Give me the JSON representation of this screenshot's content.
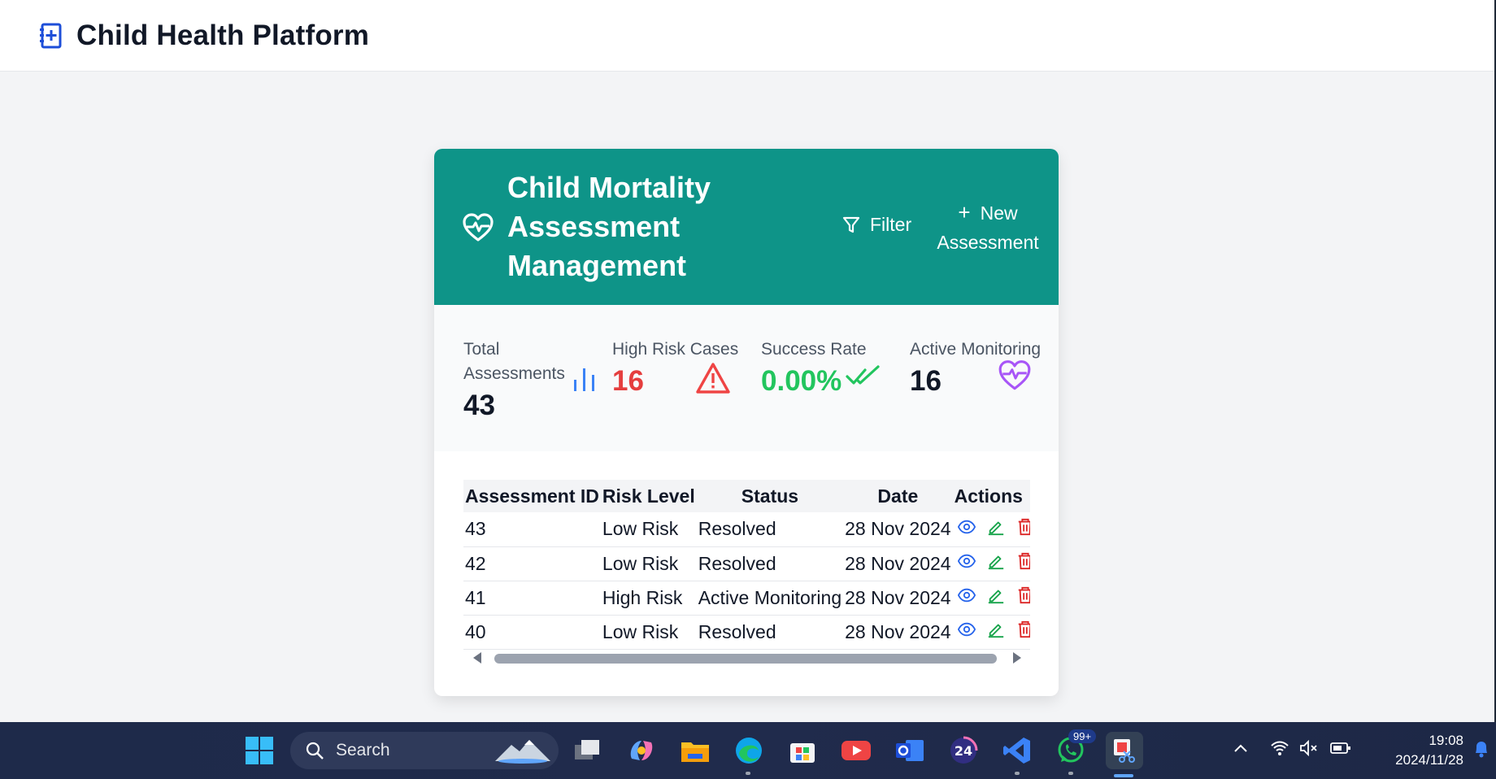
{
  "app": {
    "title": "Child Health Platform"
  },
  "card": {
    "title": "Child Mortality Assessment Management",
    "filter_label": "Filter",
    "new_label": "New Assessment"
  },
  "stats": [
    {
      "label": "Total Assessments",
      "value": "43",
      "icon": "bar-chart-icon",
      "color": "#111827"
    },
    {
      "label": "High Risk Cases",
      "value": "16",
      "icon": "warning-icon",
      "color": "#e53e3e"
    },
    {
      "label": "Success Rate",
      "value": "0.00%",
      "icon": "double-check-icon",
      "color": "#22c55e"
    },
    {
      "label": "Active Monitoring",
      "value": "16",
      "icon": "heart-pulse-icon",
      "color": "#111827"
    }
  ],
  "table": {
    "headers": [
      "Assessment ID",
      "Risk Level",
      "Status",
      "Date",
      "Actions"
    ],
    "rows": [
      {
        "id": "43",
        "risk": "Low Risk",
        "status": "Resolved",
        "date": "28 Nov 2024"
      },
      {
        "id": "42",
        "risk": "Low Risk",
        "status": "Resolved",
        "date": "28 Nov 2024"
      },
      {
        "id": "41",
        "risk": "High Risk",
        "status": "Active Monitoring",
        "date": "28 Nov 2024"
      },
      {
        "id": "40",
        "risk": "Low Risk",
        "status": "Resolved",
        "date": "28 Nov 2024"
      }
    ]
  },
  "taskbar": {
    "search_placeholder": "Search",
    "whatsapp_badge": "99+",
    "time": "19:08",
    "date": "2024/11/28"
  },
  "colors": {
    "header_teal": "#0e9488",
    "view_blue": "#2563eb",
    "edit_green": "#16a34a",
    "delete_red": "#dc2626"
  }
}
